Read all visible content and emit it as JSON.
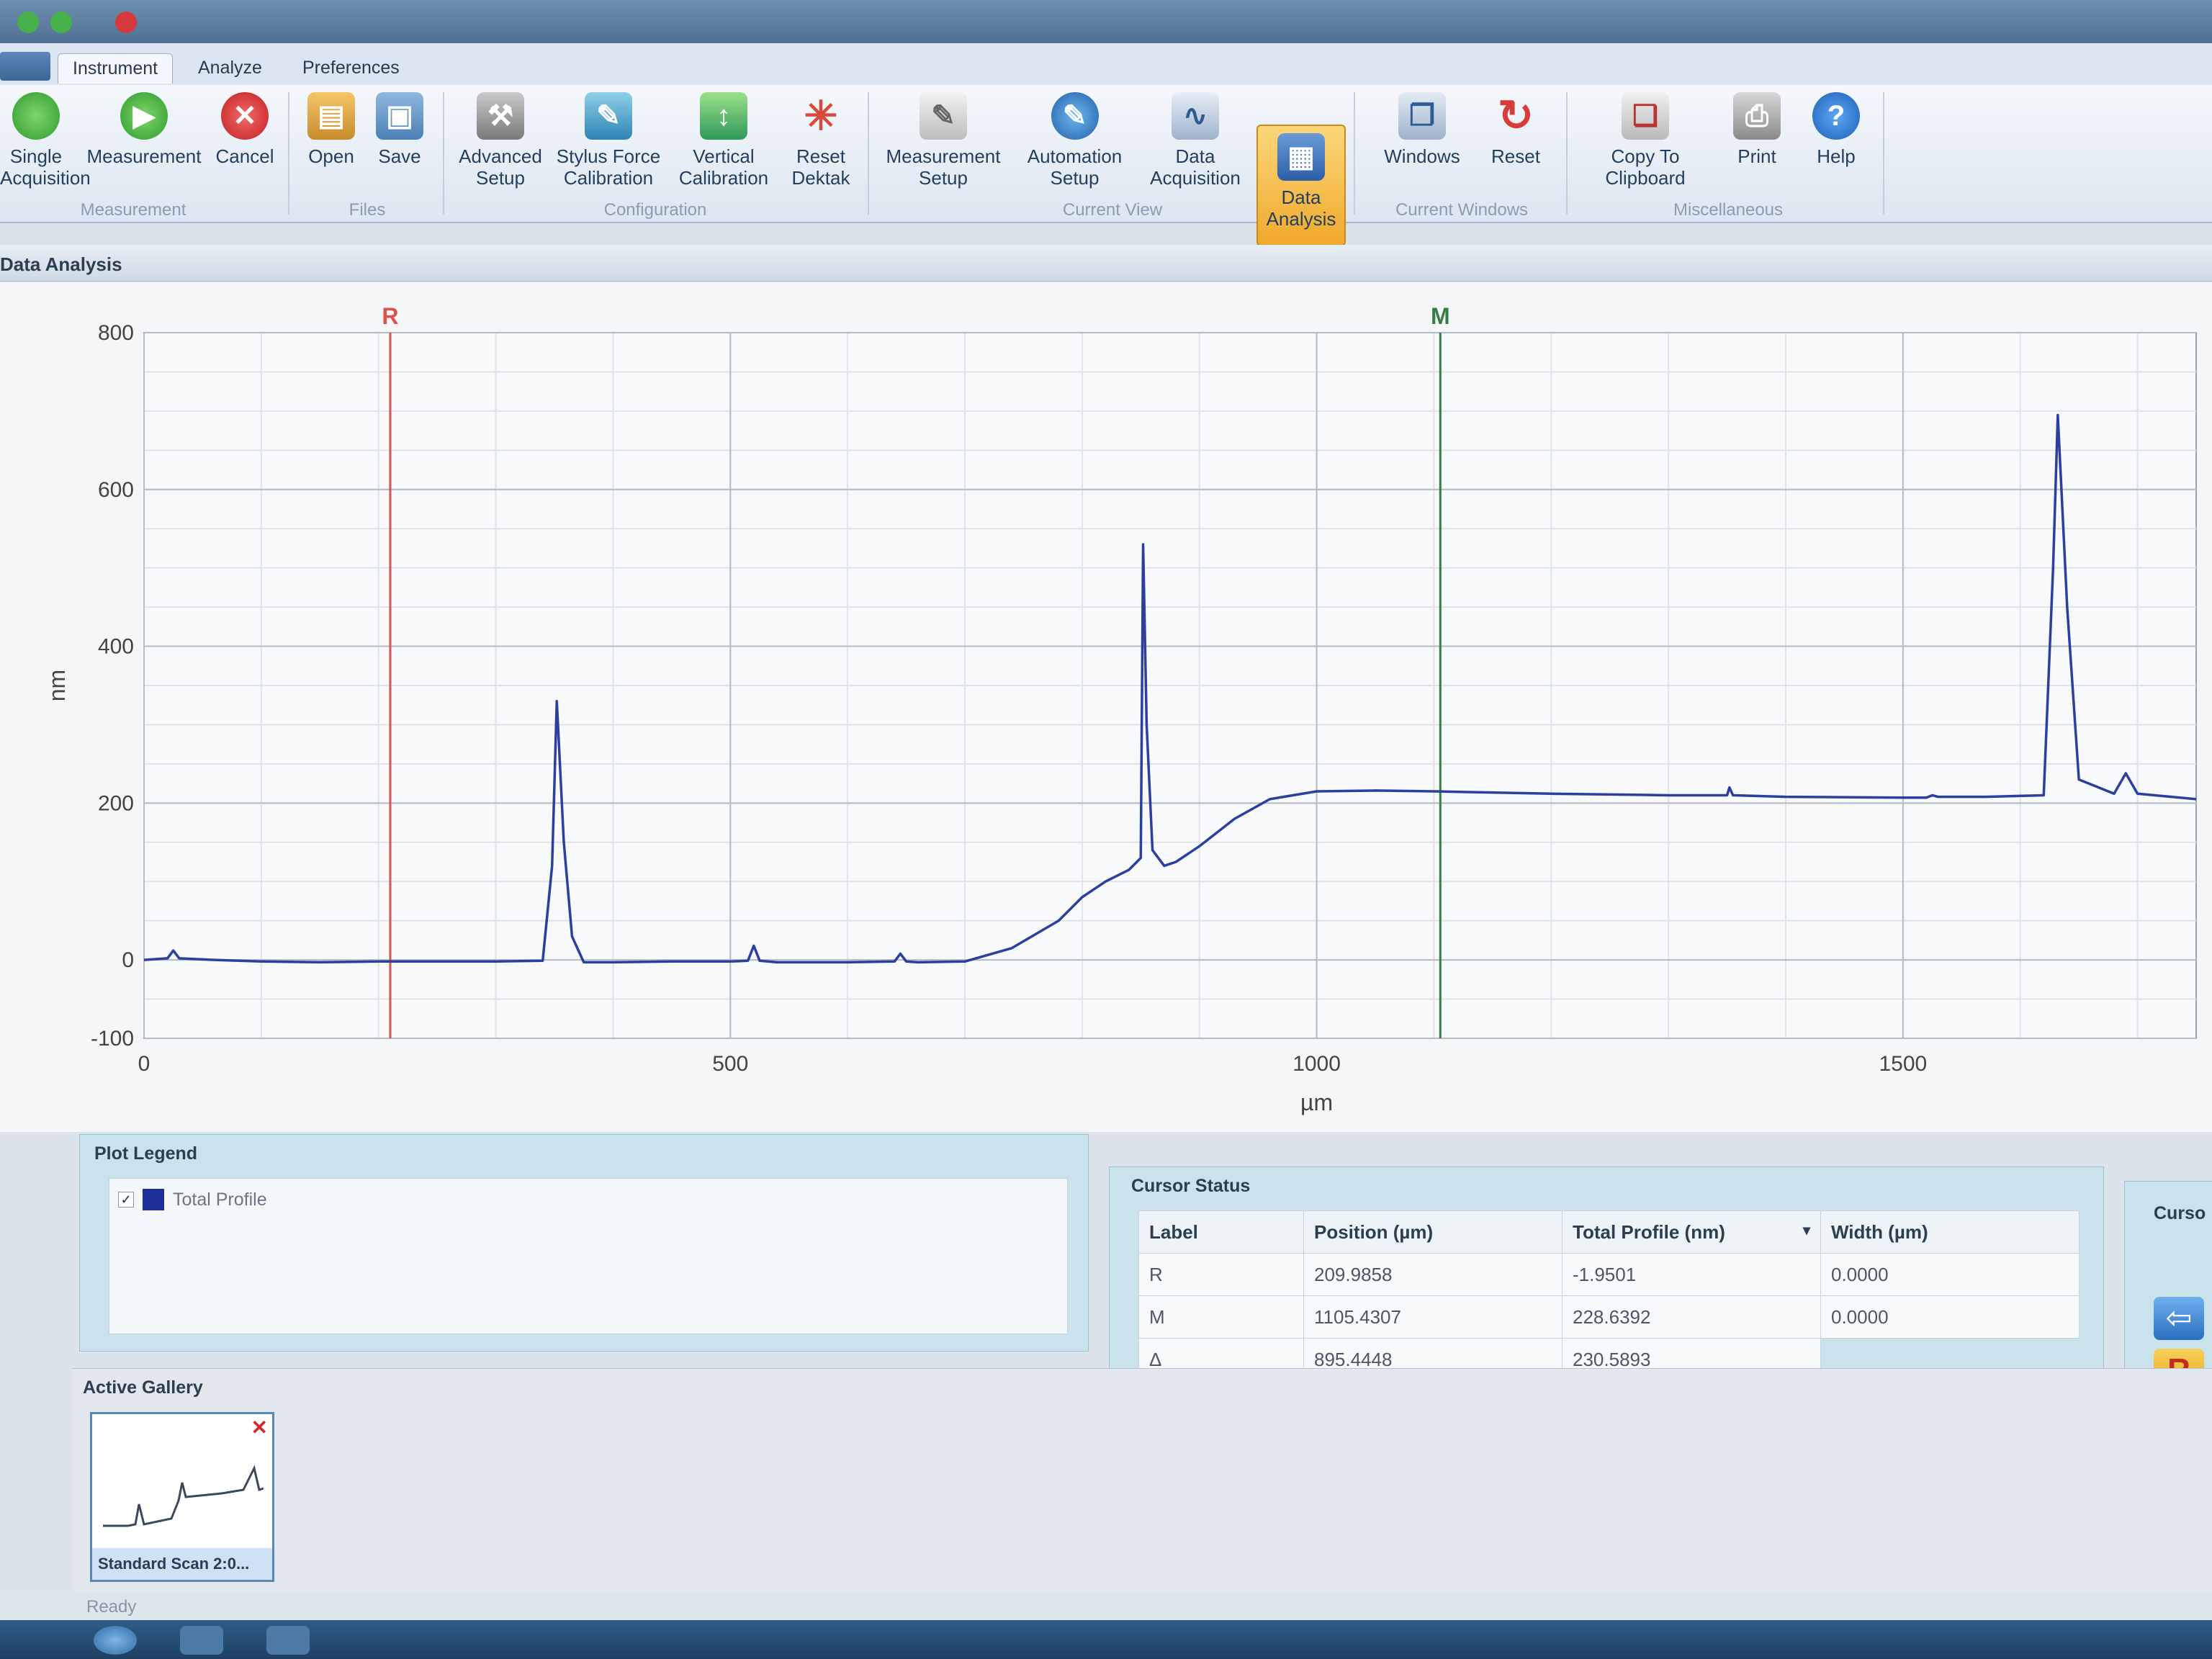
{
  "ribbon": {
    "tabs": [
      "Instrument",
      "Analyze",
      "Preferences"
    ],
    "active_tab": "Instrument",
    "groups": {
      "measurement": {
        "label": "Measurement",
        "buttons": [
          "Single Acquisition",
          "Measurement",
          "Cancel"
        ]
      },
      "files": {
        "label": "Files",
        "buttons": [
          "Open",
          "Save"
        ]
      },
      "configuration": {
        "label": "Configuration",
        "buttons": [
          "Advanced Setup",
          "Stylus Force Calibration",
          "Vertical Calibration",
          "Reset Dektak"
        ]
      },
      "current_view": {
        "label": "Current View",
        "buttons": [
          "Measurement Setup",
          "Automation Setup",
          "Data Acquisition",
          "Data Analysis"
        ],
        "selected": "Data Analysis"
      },
      "current_windows": {
        "label": "Current Windows",
        "buttons": [
          "Windows",
          "Reset"
        ]
      },
      "miscellaneous": {
        "label": "Miscellaneous",
        "buttons": [
          "Copy To Clipboard",
          "Print",
          "Help"
        ]
      }
    }
  },
  "panel": {
    "title": "Data Analysis"
  },
  "chart_data": {
    "type": "line",
    "xlabel": "µm",
    "ylabel": "nm",
    "xlim": [
      0,
      1750
    ],
    "ylim": [
      -100,
      800
    ],
    "x_ticks": [
      0,
      500,
      1000,
      1500
    ],
    "y_ticks": [
      -100,
      0,
      200,
      400,
      600,
      800
    ],
    "grid": true,
    "cursors": [
      {
        "label": "R",
        "x": 209.9858,
        "color": "#d9534f"
      },
      {
        "label": "M",
        "x": 1105.4307,
        "color": "#3a7d44"
      }
    ],
    "series": [
      {
        "name": "Total Profile",
        "color": "#2b3f9e",
        "x": [
          0,
          20,
          25,
          30,
          60,
          100,
          150,
          200,
          250,
          300,
          340,
          348,
          352,
          358,
          365,
          375,
          400,
          450,
          500,
          515,
          520,
          525,
          540,
          600,
          640,
          645,
          650,
          660,
          700,
          740,
          780,
          800,
          820,
          840,
          850,
          852,
          855,
          860,
          870,
          880,
          900,
          930,
          960,
          1000,
          1050,
          1100,
          1200,
          1300,
          1350,
          1352,
          1355,
          1400,
          1500,
          1520,
          1525,
          1530,
          1570,
          1620,
          1628,
          1632,
          1640,
          1650,
          1680,
          1690,
          1700,
          1750
        ],
        "values": [
          0,
          2,
          12,
          2,
          0,
          -2,
          -3,
          -2,
          -2,
          -2,
          -1,
          120,
          330,
          150,
          30,
          -3,
          -3,
          -2,
          -2,
          -1,
          18,
          -1,
          -3,
          -3,
          -2,
          8,
          -2,
          -3,
          -2,
          15,
          50,
          80,
          100,
          115,
          130,
          530,
          300,
          140,
          120,
          125,
          145,
          180,
          205,
          215,
          216,
          215,
          212,
          210,
          210,
          220,
          210,
          208,
          207,
          207,
          210,
          208,
          208,
          210,
          500,
          695,
          450,
          230,
          212,
          238,
          212,
          205
        ]
      }
    ]
  },
  "legend": {
    "title": "Plot Legend",
    "items": [
      {
        "label": "Total Profile",
        "checked": true,
        "color": "#1f2f9a"
      }
    ]
  },
  "cursor_status": {
    "title": "Cursor Status",
    "headers": [
      "Label",
      "Position (µm)",
      "Total Profile (nm)",
      "Width (µm)"
    ],
    "rows": [
      [
        "R",
        "209.9858",
        "-1.9501",
        "0.0000"
      ],
      [
        "M",
        "1105.4307",
        "228.6392",
        "0.0000"
      ],
      [
        "Δ",
        "895.4448",
        "230.5893",
        ""
      ]
    ],
    "side_title": "Curso"
  },
  "gallery": {
    "title": "Active Gallery",
    "items": [
      {
        "label": "Standard Scan 2:0..."
      }
    ]
  },
  "status": {
    "text": "Ready"
  }
}
